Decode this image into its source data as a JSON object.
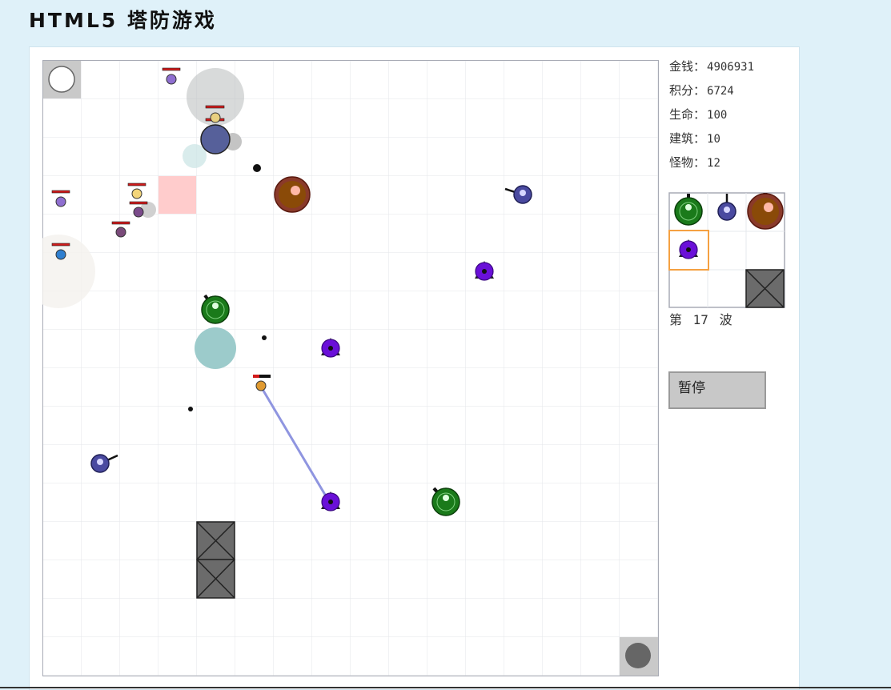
{
  "header": {
    "title": "HTML5 塔防游戏"
  },
  "stats": [
    {
      "label": "金钱：",
      "value": "4906931"
    },
    {
      "label": "积分：",
      "value": "6724"
    },
    {
      "label": "生命：",
      "value": "100"
    },
    {
      "label": "建筑：",
      "value": "10"
    },
    {
      "label": "怪物：",
      "value": "12"
    }
  ],
  "wave": {
    "prefix": "第",
    "number": "17",
    "suffix": "波"
  },
  "controls": {
    "pause_label": "暂停"
  },
  "palette": {
    "items": [
      "green-cannon-tower-icon",
      "blue-gun-tower-icon",
      "brown-heavy-tower-icon",
      "purple-laser-tower-icon",
      "wall-block-icon"
    ],
    "selected": "purple-laser-tower-icon",
    "selected_color": "#f5a142"
  },
  "colors": {
    "page_bg": "#dff1f9",
    "grid_line": "#e3e6ea",
    "green_tower": "#1a7a1a",
    "blue_tower": "#4a4aa0",
    "brown_tower": "#8a4a08",
    "purple_tower": "#6a10d8",
    "enemy_health": "#d21a1a",
    "laser_beam": "#8f95e0",
    "highlight_cell": "#ffcccc"
  }
}
